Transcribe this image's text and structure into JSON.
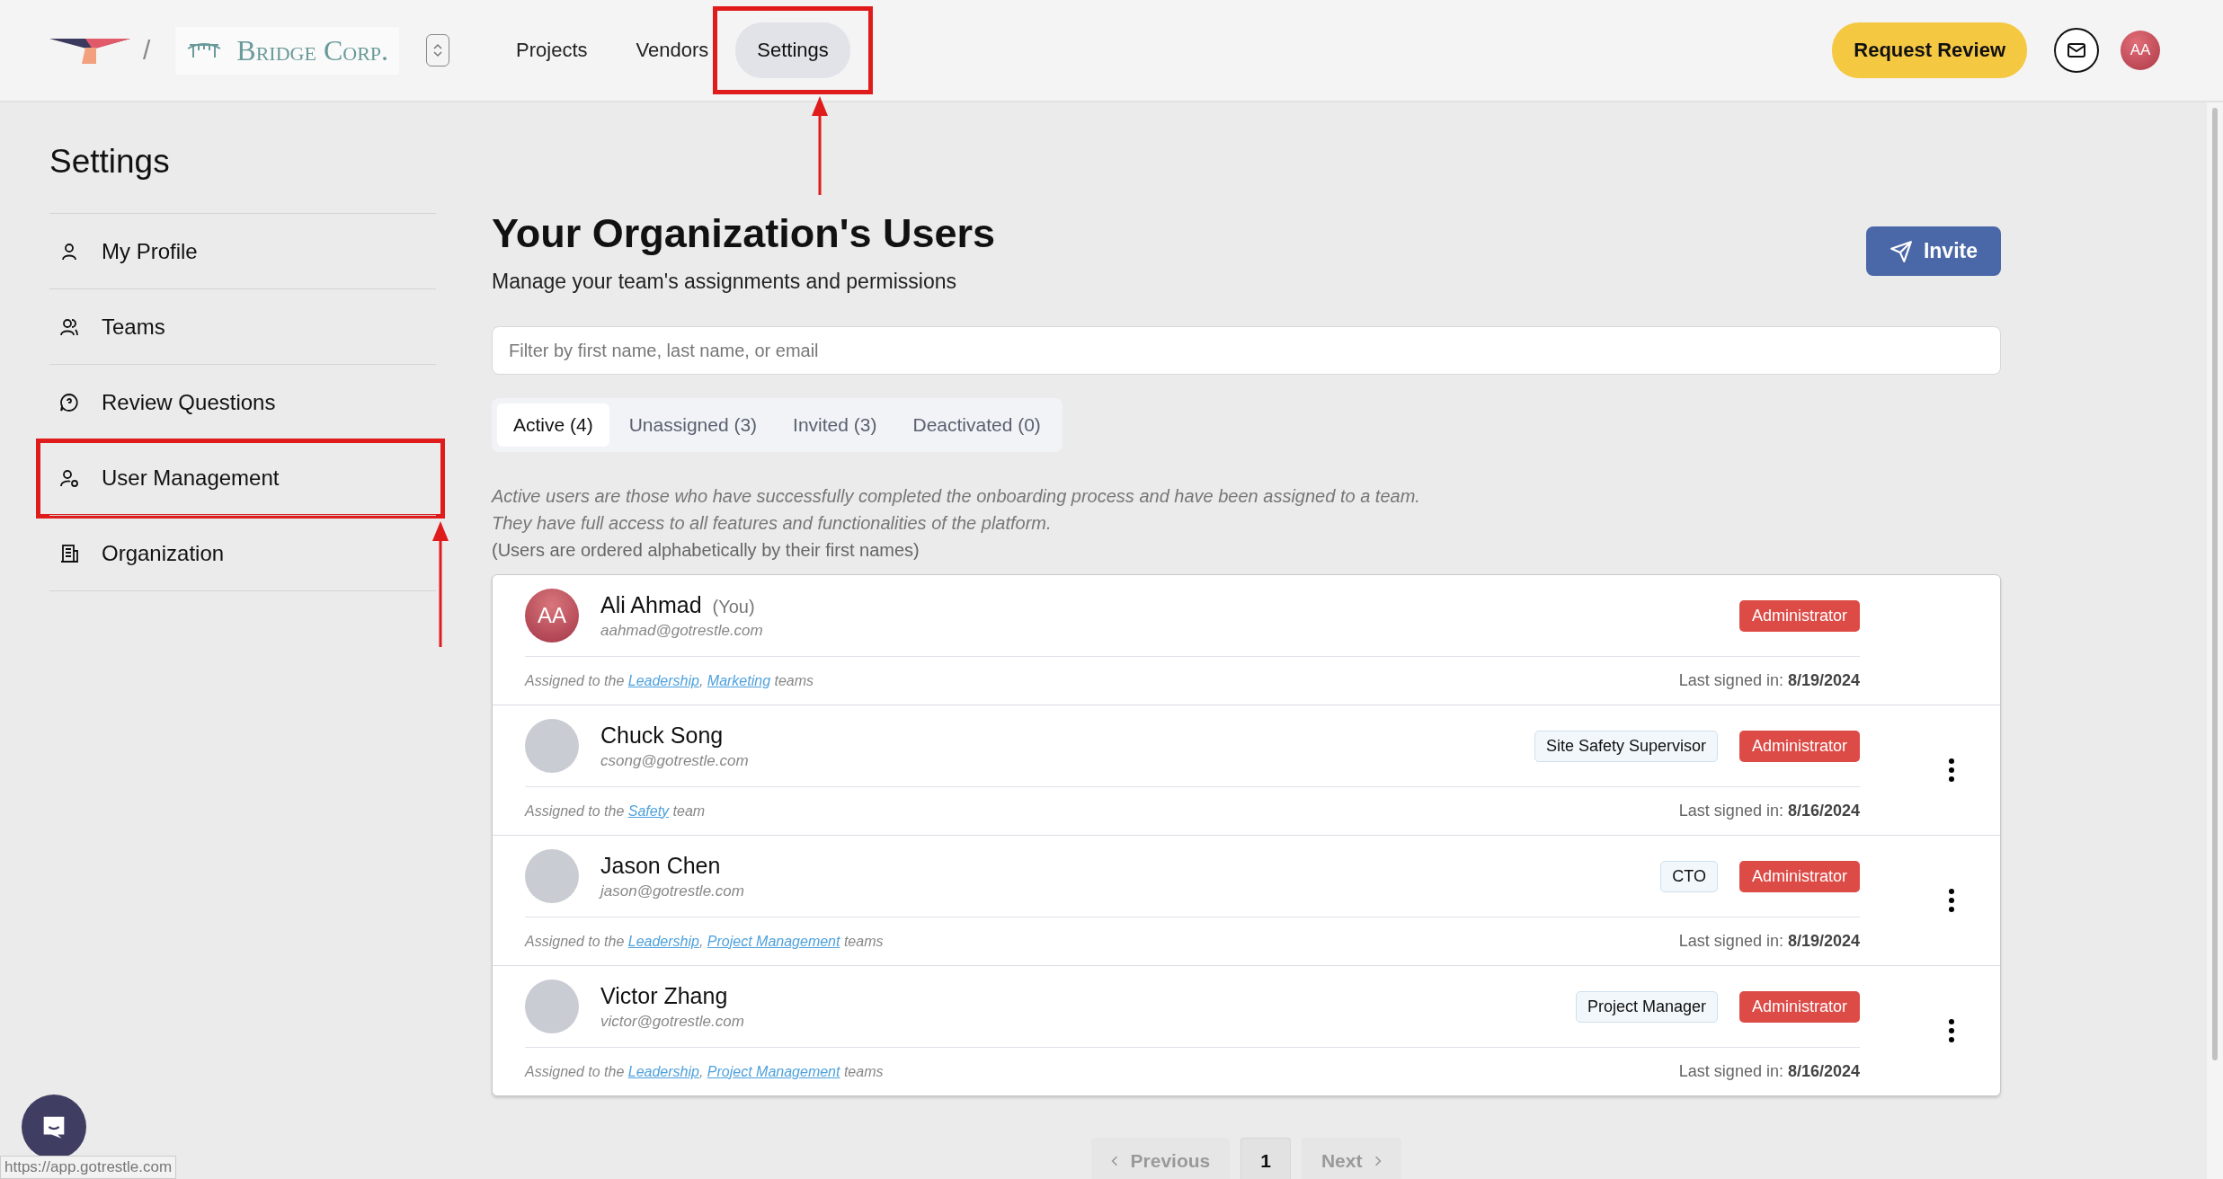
{
  "header": {
    "separator": "/",
    "org_name": "Bridge Corp.",
    "nav": [
      {
        "label": "Projects",
        "selected": false,
        "annotated": false
      },
      {
        "label": "Vendors",
        "selected": false,
        "annotated": false
      },
      {
        "label": "Settings",
        "selected": true,
        "annotated": true
      }
    ],
    "request_review": "Request Review",
    "avatar": "AA"
  },
  "sidebar": {
    "title": "Settings",
    "items": [
      {
        "label": "My Profile",
        "annotated": false
      },
      {
        "label": "Teams",
        "annotated": false
      },
      {
        "label": "Review Questions",
        "annotated": false
      },
      {
        "label": "User Management",
        "annotated": true
      },
      {
        "label": "Organization",
        "annotated": false
      }
    ]
  },
  "main": {
    "title": "Your Organization's Users",
    "subtitle": "Manage your team's assignments and permissions",
    "invite": "Invite",
    "search": {
      "placeholder": "Filter by first name, last name, or email"
    },
    "tabs": [
      {
        "label": "Active (4)",
        "selected": true
      },
      {
        "label": "Unassigned (3)",
        "selected": false
      },
      {
        "label": "Invited (3)",
        "selected": false
      },
      {
        "label": "Deactivated (0)",
        "selected": false
      }
    ],
    "description": [
      "Active users are those who have successfully completed the onboarding process and have been assigned to a team.",
      "They have full access to all features and functionalities of the platform."
    ],
    "order_note": "(Users are ordered alphabetically by their first names)",
    "users": [
      {
        "name": "Ali Ahmad",
        "you": "(You)",
        "email": "aahmad@gotrestle.com",
        "avatar": {
          "kind": "initials",
          "text": "AA"
        },
        "role": "Administrator",
        "menu": false,
        "assigned": [
          {
            "kind": "text",
            "text": "Assigned to the "
          },
          {
            "kind": "link",
            "text": "Leadership"
          },
          {
            "kind": "text",
            "text": ", "
          },
          {
            "kind": "link",
            "text": "Marketing"
          },
          {
            "kind": "text",
            "text": " teams"
          }
        ],
        "last_label": "Last signed in:",
        "last_date": "8/19/2024"
      },
      {
        "name": "Chuck Song",
        "email": "csong@gotrestle.com",
        "avatar": {
          "kind": "photo"
        },
        "title": "Site Safety Supervisor",
        "role": "Administrator",
        "menu": true,
        "assigned": [
          {
            "kind": "text",
            "text": "Assigned to the "
          },
          {
            "kind": "link",
            "text": "Safety"
          },
          {
            "kind": "text",
            "text": " team"
          }
        ],
        "last_label": "Last signed in:",
        "last_date": "8/16/2024"
      },
      {
        "name": "Jason Chen",
        "email": "jason@gotrestle.com",
        "avatar": {
          "kind": "photo"
        },
        "title": "CTO",
        "role": "Administrator",
        "menu": true,
        "assigned": [
          {
            "kind": "text",
            "text": "Assigned to the "
          },
          {
            "kind": "link",
            "text": "Leadership"
          },
          {
            "kind": "text",
            "text": ", "
          },
          {
            "kind": "link",
            "text": "Project Management"
          },
          {
            "kind": "text",
            "text": " teams"
          }
        ],
        "last_label": "Last signed in:",
        "last_date": "8/19/2024"
      },
      {
        "name": "Victor Zhang",
        "email": "victor@gotrestle.com",
        "avatar": {
          "kind": "photo"
        },
        "title": "Project Manager",
        "role": "Administrator",
        "menu": true,
        "assigned": [
          {
            "kind": "text",
            "text": "Assigned to the "
          },
          {
            "kind": "link",
            "text": "Leadership"
          },
          {
            "kind": "text",
            "text": ", "
          },
          {
            "kind": "link",
            "text": "Project Management"
          },
          {
            "kind": "text",
            "text": " teams"
          }
        ],
        "last_label": "Last signed in:",
        "last_date": "8/16/2024"
      }
    ],
    "pagination": [
      {
        "kind": "prev",
        "label": "Previous",
        "disabled": true,
        "selected": false
      },
      {
        "kind": "page",
        "label": "1",
        "disabled": false,
        "selected": true
      },
      {
        "kind": "next",
        "label": "Next",
        "disabled": true,
        "selected": false
      }
    ]
  },
  "status_url": "https://app.gotrestle.com"
}
